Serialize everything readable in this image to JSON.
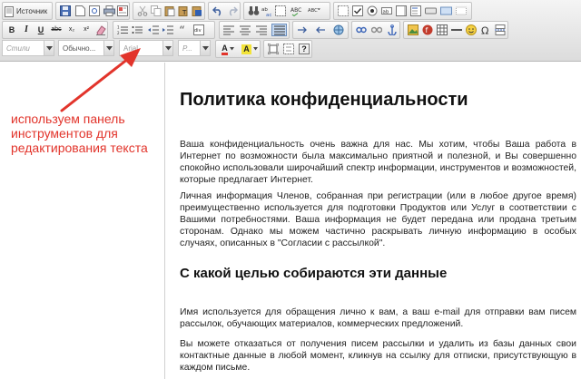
{
  "toolbar": {
    "source_label": "Источник",
    "styles_placeholder": "Стили",
    "format_value": "Обычно...",
    "font_value": "Arial",
    "size_placeholder": "Р...",
    "bold_label": "B",
    "italic_label": "I",
    "underline_label": "U",
    "strike_label": "abc",
    "subscript_label": "x₂",
    "superscript_label": "x²",
    "text_color_label": "A",
    "bg_color_label": "A",
    "help_label": "?"
  },
  "annotation": {
    "text": "используем панель инструментов для редактирования текста",
    "color": "#e2342b"
  },
  "document": {
    "title": "Политика конфиденциальности",
    "paragraphs": [
      "Ваша конфиденциальность очень важна для нас. Мы хотим, чтобы Ваша работа в Интернет по возможности была максимально приятной и полезной, и Вы совершенно спокойно использовали широчайший спектр информации, инструментов и возможностей, которые предлагает Интернет.",
      "Личная информация Членов, собранная при регистрации (или в любое другое время) преимущественно используется для подготовки Продуктов или Услуг в соответствии с Вашими потребностями. Ваша информация не будет передана или продана третьим сторонам. Однако мы можем частично раскрывать личную информацию в особых случаях, описанных в \"Согласии с рассылкой\"."
    ],
    "heading2": "С какой целью собираются эти данные",
    "paragraphs2": [
      "Имя используется для обращения лично к вам, а ваш e-mail для отправки вам писем рассылок, обучающих материалов, коммерческих предложений.",
      "Вы можете отказаться от получения писем рассылки и удалить из базы данных свои контактные данные в любой момент, кликнув на ссылку для отписки, присутствующую в каждом письме."
    ]
  },
  "colors": {
    "annotation": "#e2342b",
    "toolbar_bg": "#e4e4e4"
  }
}
